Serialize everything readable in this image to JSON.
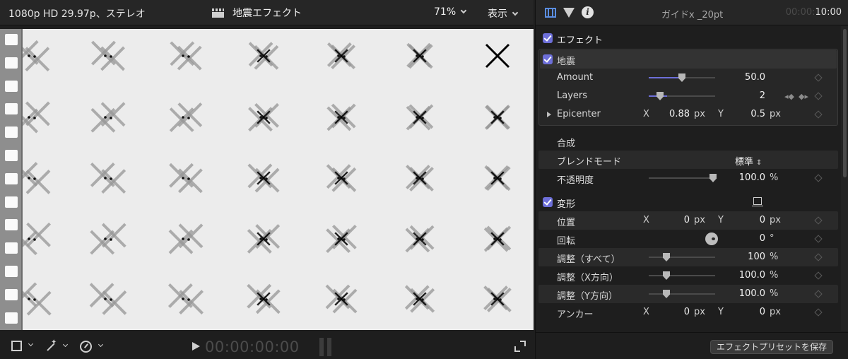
{
  "viewer": {
    "format": "1080p HD 29.97p、ステレオ",
    "title": "地震エフェクト",
    "zoom": "71%",
    "view_menu": "表示",
    "timecode": "00:00:00:00"
  },
  "inspector": {
    "clip_name": "ガイドx _20pt",
    "duration_dim": "00:00:",
    "duration_bright": "10:00",
    "effects_header": "エフェクト",
    "effect_name": "地震",
    "amount": {
      "label": "Amount",
      "value": "50.0",
      "level": 0.5
    },
    "layers": {
      "label": "Layers",
      "value": "2",
      "level": 0.15
    },
    "epicenter": {
      "label": "Epicenter",
      "x_axis": "X",
      "x_value": "0.88",
      "x_unit": "px",
      "y_axis": "Y",
      "y_value": "0.5",
      "y_unit": "px"
    },
    "compositing": {
      "header": "合成",
      "blend_label": "ブレンドモード",
      "blend_value": "標準",
      "opacity_label": "不透明度",
      "opacity_value": "100.0",
      "opacity_unit": "%"
    },
    "transform": {
      "header": "変形",
      "position": {
        "label": "位置",
        "x_axis": "X",
        "x_value": "0",
        "x_unit": "px",
        "y_axis": "Y",
        "y_value": "0",
        "y_unit": "px"
      },
      "rotation": {
        "label": "回転",
        "value": "0",
        "unit": "°"
      },
      "scale_all": {
        "label": "調整（すべて）",
        "value": "100",
        "unit": "%"
      },
      "scale_x": {
        "label": "調整（X方向）",
        "value": "100.0",
        "unit": "%"
      },
      "scale_y": {
        "label": "調整（Y方向）",
        "value": "100.0",
        "unit": "%"
      },
      "anchor": {
        "label": "アンカー",
        "x_axis": "X",
        "x_value": "0",
        "x_unit": "px",
        "y_axis": "Y",
        "y_value": "0",
        "y_unit": "px"
      }
    },
    "save_preset": "エフェクトプリセットを保存"
  },
  "colors": {
    "accent": "#6d6fd9",
    "canvas": "#ececec",
    "panel": "#1e1e1e"
  },
  "icons": [
    "clapper-icon",
    "chevron-down-icon",
    "crop-icon",
    "magic-wand-icon",
    "speed-icon",
    "play-icon",
    "fullscreen-icon",
    "video-inspector-icon",
    "filter-icon",
    "info-icon",
    "checkbox-icon",
    "keyframe-icon",
    "disclosure-triangle-icon",
    "rotation-dial-icon",
    "transform-onscreen-icon"
  ]
}
